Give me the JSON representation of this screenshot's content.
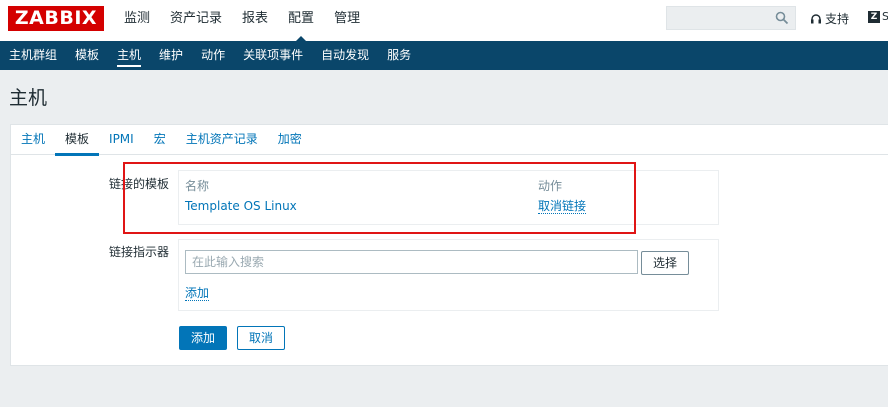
{
  "header": {
    "logo": "ZABBIX",
    "menu": [
      "监测",
      "资产记录",
      "报表",
      "配置",
      "管理"
    ],
    "active_menu": "配置",
    "search": {
      "value": "",
      "placeholder": ""
    },
    "support_label": "支持",
    "share_label": "S"
  },
  "subnav": {
    "items": [
      "主机群组",
      "模板",
      "主机",
      "维护",
      "动作",
      "关联项事件",
      "自动发现",
      "服务"
    ],
    "active": "主机"
  },
  "page": {
    "title": "主机"
  },
  "tabs": {
    "items": [
      "主机",
      "模板",
      "IPMI",
      "宏",
      "主机资产记录",
      "加密"
    ],
    "active": "模板"
  },
  "linked_templates": {
    "label": "链接的模板",
    "col_name": "名称",
    "col_action": "动作",
    "rows": [
      {
        "name": "Template OS Linux",
        "action": "取消链接"
      }
    ]
  },
  "link_indicator": {
    "label": "链接指示器",
    "search_placeholder": "在此输入搜索",
    "select_label": "选择",
    "add_link": "添加"
  },
  "form_buttons": {
    "add": "添加",
    "cancel": "取消"
  },
  "colors": {
    "brand": "#d40000",
    "nav": "#0a466a",
    "link": "#0275b8",
    "highlight": "#e01515"
  }
}
